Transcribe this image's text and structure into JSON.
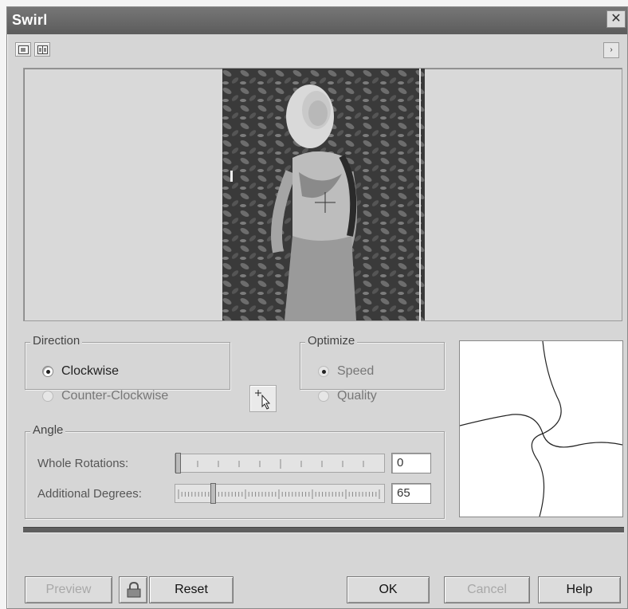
{
  "window": {
    "title": "Swirl",
    "close_glyph": "✕"
  },
  "toolbar": {
    "icons": [
      "split-preview-icon",
      "dual-preview-icon"
    ],
    "menu_arrow_glyph": "›"
  },
  "direction": {
    "title": "Direction",
    "options": [
      {
        "label": "Clockwise",
        "selected": true,
        "enabled": true
      },
      {
        "label": "Counter-Clockwise",
        "selected": false,
        "enabled": false
      }
    ]
  },
  "optimize": {
    "title": "Optimize",
    "options": [
      {
        "label": "Speed",
        "selected": true,
        "enabled": false
      },
      {
        "label": "Quality",
        "selected": false,
        "enabled": false
      }
    ]
  },
  "angle": {
    "title": "Angle",
    "whole_rotations": {
      "label": "Whole Rotations:",
      "value": "0"
    },
    "additional_degrees": {
      "label": "Additional Degrees:",
      "value": "65"
    }
  },
  "buttons": {
    "preview": "Preview",
    "reset": "Reset",
    "ok": "OK",
    "cancel": "Cancel",
    "help": "Help"
  },
  "colors": {
    "dialog_bg": "#d6d6d6",
    "titlebar": "#6a6a6a",
    "separator": "#5e5e5e"
  }
}
